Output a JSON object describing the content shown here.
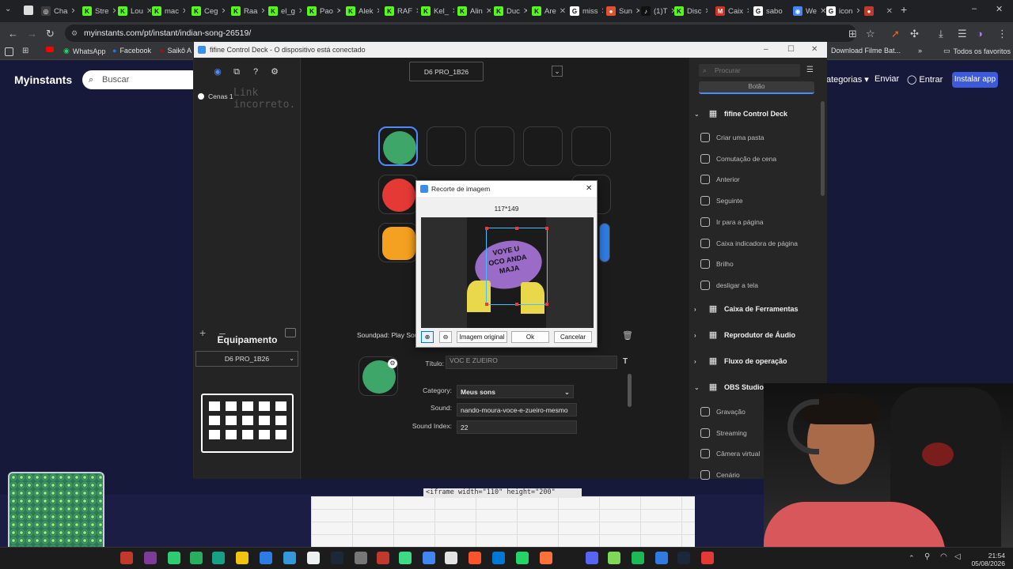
{
  "browser": {
    "tabs": [
      {
        "label": "Cha",
        "color": "#3c3c3c",
        "glyph": "◎"
      },
      {
        "label": "Stre",
        "color": "#53fc18",
        "glyph": "K"
      },
      {
        "label": "Lou",
        "color": "#53fc18",
        "glyph": "K"
      },
      {
        "label": "mac",
        "color": "#53fc18",
        "glyph": "K"
      },
      {
        "label": "Ceg",
        "color": "#53fc18",
        "glyph": "K"
      },
      {
        "label": "Raa",
        "color": "#53fc18",
        "glyph": "K"
      },
      {
        "label": "el_g",
        "color": "#53fc18",
        "glyph": "K"
      },
      {
        "label": "Pao",
        "color": "#53fc18",
        "glyph": "K"
      },
      {
        "label": "Alek",
        "color": "#53fc18",
        "glyph": "K"
      },
      {
        "label": "RAF",
        "color": "#53fc18",
        "glyph": "K"
      },
      {
        "label": "Kel_",
        "color": "#53fc18",
        "glyph": "K"
      },
      {
        "label": "Alin",
        "color": "#53fc18",
        "glyph": "K"
      },
      {
        "label": "Duc",
        "color": "#53fc18",
        "glyph": "K"
      },
      {
        "label": "Are",
        "color": "#53fc18",
        "glyph": "K"
      },
      {
        "label": "miss",
        "color": "#ffffff",
        "glyph": "G"
      },
      {
        "label": "Sun",
        "color": "#e0522f",
        "glyph": "●"
      },
      {
        "label": "(1)T",
        "color": "#111111",
        "glyph": "♪"
      },
      {
        "label": "Disc",
        "color": "#53fc18",
        "glyph": "K"
      },
      {
        "label": "Caix",
        "color": "#d93025",
        "glyph": "M"
      },
      {
        "label": "sabo",
        "color": "#ffffff",
        "glyph": "G"
      },
      {
        "label": "We",
        "color": "#4285f4",
        "glyph": "◉"
      },
      {
        "label": "icon",
        "color": "#ffffff",
        "glyph": "G"
      },
      {
        "label": "",
        "color": "#c0392b",
        "glyph": "●"
      }
    ],
    "url": "myinstants.com/pt/instant/indian-song-26519/",
    "bookmarks": {
      "whatsapp": "WhatsApp",
      "facebook": "Facebook",
      "saiko": "Saikô A",
      "download": "Download Filme Bat...",
      "all": "Todos os favoritos"
    }
  },
  "site": {
    "logo": "Myinstants",
    "search_placeholder": "Buscar",
    "link_categorias": "ategorias ▾",
    "link_enviar": "Enviar",
    "link_entrar": "Entrar",
    "install": "Instalar app",
    "broken_link": "Link incorreto.",
    "iframe_snippet": "<iframe width=\"110\" height=\"200\""
  },
  "app": {
    "title": "fifine Control Deck - O dispositivo está conectado",
    "device_tab": "D6 PRO_1B26",
    "scene": "Cenas 1",
    "equipment_label": "Equipamento",
    "equipment_value": "D6 PRO_1B26",
    "search_placeholder": "Procurar",
    "button_tab": "Botão",
    "action_title": "Soundpad: Play Sou",
    "fields": {
      "title_label": "Título:",
      "title_value": "VOC E ZUEIRO",
      "category_label": "Category:",
      "category_value": "Meus sons",
      "sound_label": "Sound:",
      "sound_value": "nando-moura-voce-e-zueiro-mesmo",
      "index_label": "Sound Index:",
      "index_value": "22"
    },
    "key_icon_text": "VOC E ZUEIRO",
    "right_groups": {
      "deck": {
        "title": "fifine Control Deck",
        "items": [
          "Criar uma pasta",
          "Comutação de cena",
          "Anterior",
          "Seguinte",
          "Ir para a página",
          "Caixa indicadora de página",
          "Brilho",
          "desligar a tela"
        ]
      },
      "tools": "Caixa de Ferramentas",
      "audio": "Reprodutor de Áudio",
      "flow": "Fluxo de operação",
      "obs": {
        "title": "OBS Studio",
        "items": [
          "Gravação",
          "Streaming",
          "Câmera virtual",
          "Cenário"
        ]
      }
    }
  },
  "dialog": {
    "title": "Recorte de imagem",
    "size": "117*149",
    "btn_original": "Imagem original",
    "btn_ok": "Ok",
    "btn_cancel": "Cancelar",
    "art_text": [
      "VOYE U",
      "OCO ANDA",
      "MAJA"
    ]
  },
  "taskbar": {
    "time": "21:54",
    "date": "05/08/2026"
  },
  "colors": {
    "accent": "#4a8bff",
    "key_green": "#3fa66a",
    "key_red": "#e53935",
    "key_orange": "#f4a020",
    "site_bg": "#17193b"
  }
}
